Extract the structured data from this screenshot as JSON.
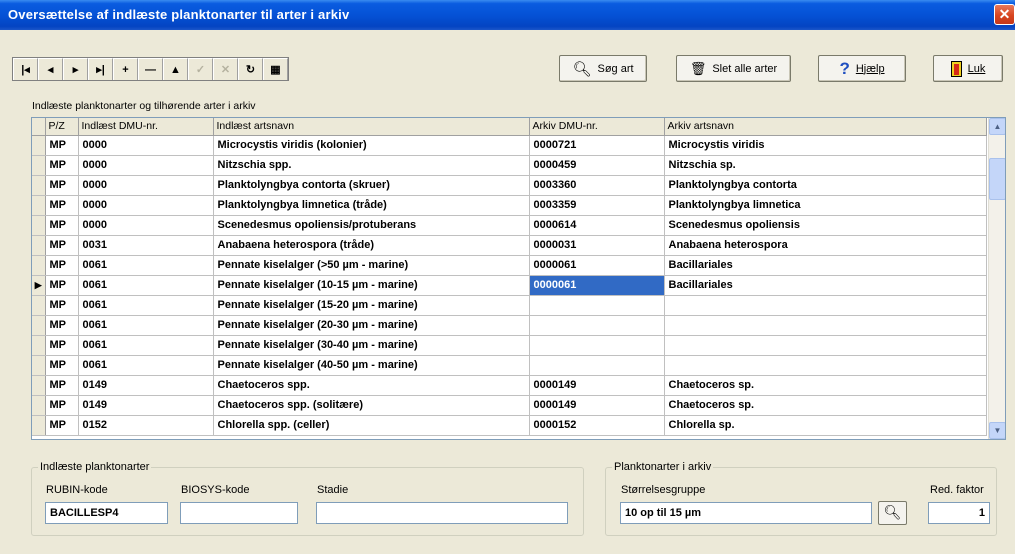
{
  "window": {
    "title": "Oversættelse af indlæste planktonarter til arter i arkiv",
    "close_glyph": "✕"
  },
  "navigator": [
    {
      "name": "first-record-button",
      "glyph": "|◂",
      "enabled": true
    },
    {
      "name": "prior-record-button",
      "glyph": "◂",
      "enabled": true
    },
    {
      "name": "next-record-button",
      "glyph": "▸",
      "enabled": true
    },
    {
      "name": "last-record-button",
      "glyph": "▸|",
      "enabled": true
    },
    {
      "name": "insert-record-button",
      "glyph": "+",
      "enabled": true
    },
    {
      "name": "delete-record-button",
      "glyph": "—",
      "enabled": true
    },
    {
      "name": "edit-record-button",
      "glyph": "▲",
      "enabled": true
    },
    {
      "name": "post-edit-button",
      "glyph": "✓",
      "enabled": false
    },
    {
      "name": "cancel-edit-button",
      "glyph": "✕",
      "enabled": false
    },
    {
      "name": "refresh-button",
      "glyph": "↻",
      "enabled": true
    },
    {
      "name": "export-button",
      "glyph": "▦",
      "enabled": true
    }
  ],
  "buttons": {
    "search": {
      "label": "Søg art",
      "icon": "magnifier-icon"
    },
    "delete_all": {
      "label": "Slet alle arter",
      "icon": "trash-icon"
    },
    "help": {
      "label": "Hjælp",
      "icon": "question-icon"
    },
    "close": {
      "label": "Luk",
      "icon": "door-exit-icon"
    }
  },
  "grid": {
    "caption": "Indlæste planktonarter og tilhørende arter i arkiv",
    "columns": [
      "P/Z",
      "Indlæst DMU-nr.",
      "Indlæst artsnavn",
      "Arkiv DMU-nr.",
      "Arkiv artsnavn"
    ],
    "current_row_indicator": "▶",
    "rows": [
      {
        "pz": "MP",
        "in_dmu": "0000",
        "in_name": "Microcystis viridis  (kolonier)",
        "ark_dmu": "0000721",
        "ark_name": "Microcystis viridis",
        "current": false
      },
      {
        "pz": "MP",
        "in_dmu": "0000",
        "in_name": "Nitzschia spp.",
        "ark_dmu": "0000459",
        "ark_name": "Nitzschia sp.",
        "current": false
      },
      {
        "pz": "MP",
        "in_dmu": "0000",
        "in_name": "Planktolyngbya contorta  (skruer)",
        "ark_dmu": "0003360",
        "ark_name": "Planktolyngbya contorta",
        "current": false
      },
      {
        "pz": "MP",
        "in_dmu": "0000",
        "in_name": "Planktolyngbya limnetica  (tråde)",
        "ark_dmu": "0003359",
        "ark_name": "Planktolyngbya limnetica",
        "current": false
      },
      {
        "pz": "MP",
        "in_dmu": "0000",
        "in_name": "Scenedesmus opoliensis/protuberans",
        "ark_dmu": "0000614",
        "ark_name": "Scenedesmus opoliensis",
        "current": false
      },
      {
        "pz": "MP",
        "in_dmu": "0031",
        "in_name": "Anabaena heterospora  (tråde)",
        "ark_dmu": "0000031",
        "ark_name": "Anabaena heterospora",
        "current": false
      },
      {
        "pz": "MP",
        "in_dmu": "0061",
        "in_name": "Pennate kiselalger (>50 µm - marine)",
        "ark_dmu": "0000061",
        "ark_name": "Bacillariales",
        "current": false
      },
      {
        "pz": "MP",
        "in_dmu": "0061",
        "in_name": "Pennate kiselalger (10-15 µm - marine)",
        "ark_dmu": "0000061",
        "ark_name": "Bacillariales",
        "current": true
      },
      {
        "pz": "MP",
        "in_dmu": "0061",
        "in_name": "Pennate kiselalger (15-20 µm - marine)",
        "ark_dmu": "",
        "ark_name": "",
        "current": false
      },
      {
        "pz": "MP",
        "in_dmu": "0061",
        "in_name": "Pennate kiselalger (20-30 µm - marine)",
        "ark_dmu": "",
        "ark_name": "",
        "current": false
      },
      {
        "pz": "MP",
        "in_dmu": "0061",
        "in_name": "Pennate kiselalger (30-40 µm - marine)",
        "ark_dmu": "",
        "ark_name": "",
        "current": false
      },
      {
        "pz": "MP",
        "in_dmu": "0061",
        "in_name": "Pennate kiselalger (40-50 µm - marine)",
        "ark_dmu": "",
        "ark_name": "",
        "current": false
      },
      {
        "pz": "MP",
        "in_dmu": "0149",
        "in_name": "Chaetoceros spp.",
        "ark_dmu": "0000149",
        "ark_name": "Chaetoceros sp.",
        "current": false
      },
      {
        "pz": "MP",
        "in_dmu": "0149",
        "in_name": "Chaetoceros spp.  (solitære)",
        "ark_dmu": "0000149",
        "ark_name": "Chaetoceros sp.",
        "current": false
      },
      {
        "pz": "MP",
        "in_dmu": "0152",
        "in_name": "Chlorella spp.  (celler)",
        "ark_dmu": "0000152",
        "ark_name": "Chlorella sp.",
        "current": false
      }
    ]
  },
  "imported_group": {
    "legend": "Indlæste planktonarter",
    "rubin_label": "RUBIN-kode",
    "rubin_value": "BACILLESP4",
    "biosys_label": "BIOSYS-kode",
    "biosys_value": "",
    "stadie_label": "Stadie",
    "stadie_value": ""
  },
  "archive_group": {
    "legend": "Planktonarter i arkiv",
    "size_label": "Størrelsesgruppe",
    "size_value": "10 op til 15 µm",
    "factor_label": "Red. faktor",
    "factor_value": "1"
  },
  "colors": {
    "title_blue": "#0552d6",
    "selection": "#316ac5",
    "face": "#ece9d8"
  }
}
